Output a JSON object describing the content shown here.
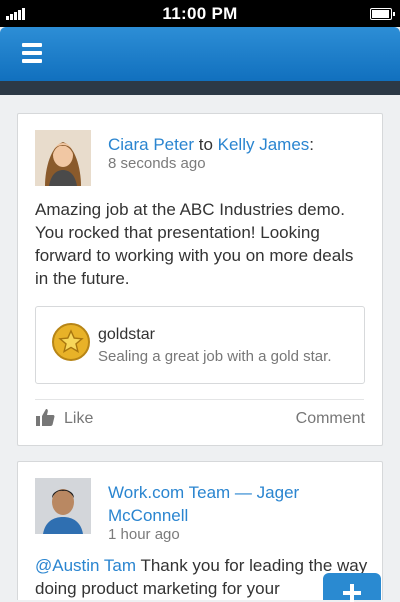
{
  "status_bar": {
    "time": "11:00 PM",
    "signal_bars": 5,
    "battery_level": 0.95
  },
  "header": {
    "menu_icon": "hamburger-menu-icon"
  },
  "feed": {
    "posts": [
      {
        "author": "Ciara Peter",
        "connector": "to",
        "recipient": "Kelly James",
        "punctuation": ":",
        "time": "8 seconds ago",
        "avatar_icon": "user-photo",
        "body": "Amazing job at the ABC Industries demo. You rocked that presentation! Looking forward to working with you on more deals in the future.",
        "attachment": {
          "icon": "gold-star-icon",
          "title": "goldstar",
          "description": "Sealing a great job with a gold star."
        },
        "actions": {
          "like_label": "Like",
          "comment_label": "Comment"
        }
      },
      {
        "author": "Work.com Team",
        "connector": "—",
        "recipient": "Jager McConnell",
        "time": "1 hour ago",
        "avatar_icon": "user-photo",
        "mention": "@Austin Tam",
        "body": " Thank you for leading the way doing product marketing for your"
      }
    ]
  },
  "fab": {
    "icon": "plus-icon"
  },
  "colors": {
    "header_blue": "#1d7fcb",
    "link_blue": "#2a85d0",
    "gold_star": "#e8b228"
  }
}
